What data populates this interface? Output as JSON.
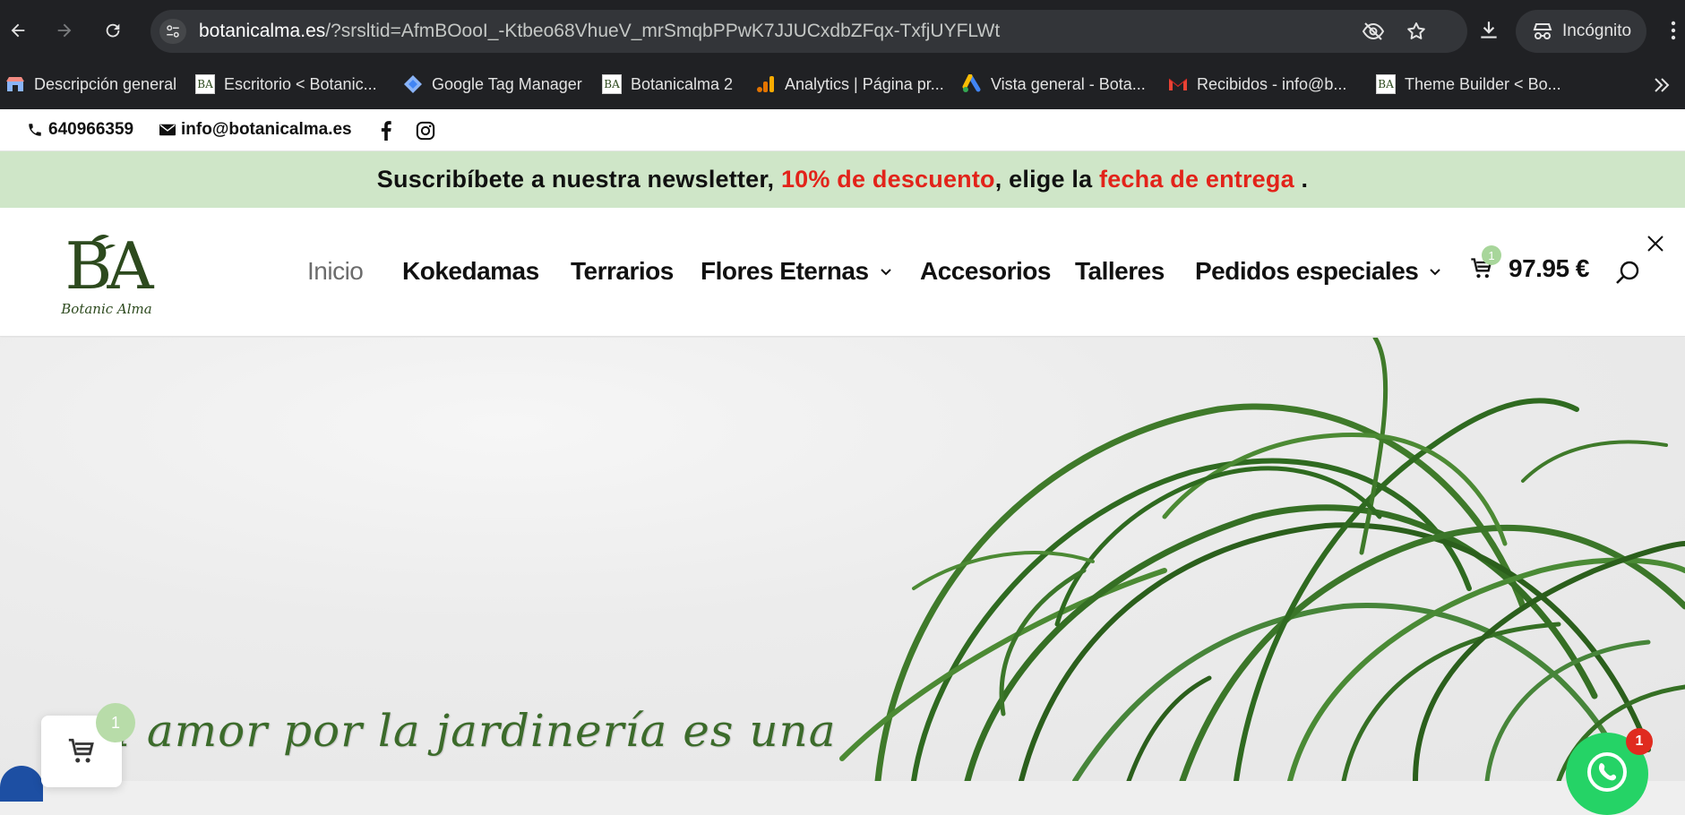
{
  "browser": {
    "url_host": "botanicalma.es",
    "url_path": "/?srsltid=AfmBOooI_-Ktbeo68VhueV_mrSmqbPPwK7JJUCxdbZFqx-TxfjUYFLWt",
    "incognito_label": "Incógnito",
    "bookmarks": [
      {
        "label": "Descripción general",
        "icon": "store-icon"
      },
      {
        "label": "Escritorio < Botanic...",
        "icon": "ba-favicon"
      },
      {
        "label": "Google Tag Manager",
        "icon": "tag-manager-icon"
      },
      {
        "label": "Botanicalma 2",
        "icon": "ba-favicon"
      },
      {
        "label": "Analytics | Página pr...",
        "icon": "analytics-icon"
      },
      {
        "label": "Vista general - Bota...",
        "icon": "google-ads-icon"
      },
      {
        "label": "Recibidos - info@b...",
        "icon": "gmail-icon"
      },
      {
        "label": "Theme Builder < Bo...",
        "icon": "ba-favicon"
      }
    ]
  },
  "topbar": {
    "phone": "640966359",
    "email": "info@botanicalma.es"
  },
  "promo": {
    "part1": "Suscribíbete a nuestra newsletter, ",
    "highlight1": "10% de descuento",
    "part2": ", elige la ",
    "highlight2": "fecha de entrega",
    "part3": " ."
  },
  "header": {
    "logo_monogram": "BA",
    "logo_script": "Botanic Alma",
    "menu": [
      {
        "label": "Inicio",
        "active": true
      },
      {
        "label": "Kokedamas"
      },
      {
        "label": "Terrarios"
      },
      {
        "label": "Flores Eternas",
        "dropdown": true
      },
      {
        "label": "Accesorios"
      },
      {
        "label": "Talleres"
      },
      {
        "label": "Pedidos especiales",
        "dropdown": true
      }
    ],
    "cart_count": "1",
    "cart_total": "97.95 €"
  },
  "hero": {
    "tagline": "l amor por la jardinería es una"
  },
  "floating": {
    "cart_count": "1",
    "whatsapp_count": "1"
  },
  "colors": {
    "brand_green": "#2d4a1e",
    "promo_bg": "#cfe6c8",
    "accent_red": "#e2231a",
    "whatsapp_green": "#25d366"
  }
}
